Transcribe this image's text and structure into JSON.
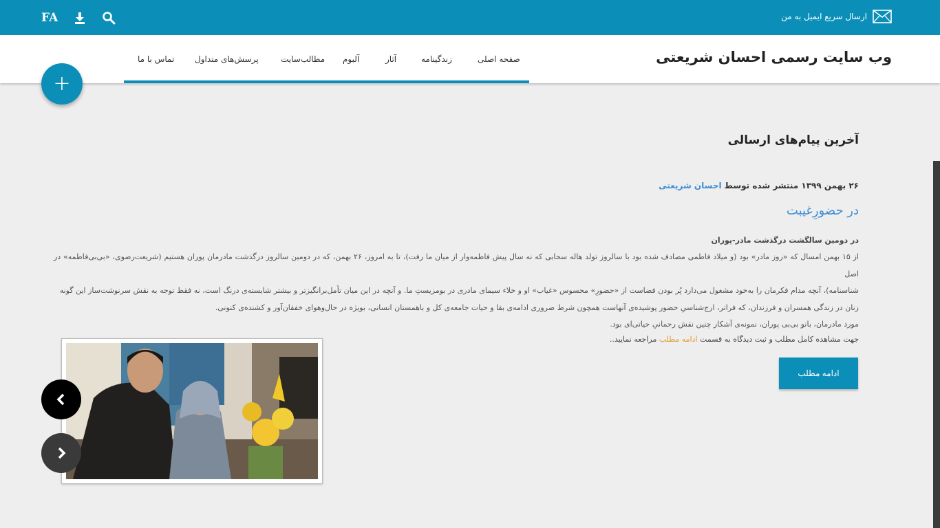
{
  "topbar": {
    "lang_label": "FA",
    "mail_label": "ارسال سریع ایمیل به من",
    "icons": [
      "search-icon",
      "download-icon",
      "mail-icon"
    ]
  },
  "header": {
    "site_title": "وب سایت رسمی احسان شریعتی",
    "nav": [
      {
        "label": "صفحه اصلی"
      },
      {
        "label": "زندگینامه"
      },
      {
        "label": "آثار"
      },
      {
        "label": "آلبوم"
      },
      {
        "label": "مطالب‌سایت"
      },
      {
        "label": "پرسش‌های متداول"
      },
      {
        "label": "تماس با ما"
      }
    ],
    "fab_label": "+"
  },
  "content": {
    "section_title": "آخرین پیام‌های ارسالی",
    "meta_prefix": "۲۶ بهمن ۱۳۹۹ منتشر شده توسط",
    "meta_author": "احسان شریعتی",
    "post_title": "در حضورِغیبت",
    "subtitle": "در دومین سالگشت درگذشت مادر-پوران",
    "body_lines": [
      "از ۱۵ بهمن امسال که «روز مادر» بود (و میلاد فاطمی مصادف شده بود با سالروز تولد هاله سحابی که نه سال پیش فاطمه‌وار از میان ما رفت)، تا به امروز، ۲۶ بهمن، که در دومین سالروز درگذشت مادرمان پوران هستیم (شریعت‌رضوی، «بی‌بی‌فاطمه» در اصل",
      "شناسنامه)، آنچه مدام فکرمان را به‌خود مشغول می‌دارد پُر بودن فضاست از «حضورِ» محسوس «غیاب» او و خلاء سیمای مادری در بومزیستِ ما. و آنچه در این میان تأمل‌برانگیزتر و بیشتر شایسته‌ی درنگ است، نه فقط توجه به نقش سرنوشت‌ساز این گونه",
      "زنان در زندگی همسران و فرزندان، که فراتر، ارج‌شناسیِ حضور پوشیده‌ی آنهاست همچون شرط ضروری ادامه‌ی بقا و حیات جامعه‌ی کل و باهمستان انسانی، بویژه در حال‌وهوای خفقان‌آور و کشنده‌ی کنونی.",
      "مورد مادرمان، بانو بی‌بی پوران، نمونه‌ی آشکار چنین نقش رحمانیِ حیاتی‌ای بود."
    ],
    "readmore_prefix": "جهت مشاهده کامل مطلب و ثبت دیدگاه به قسمت",
    "readmore_link": "ادامه مطلب",
    "readmore_suffix": "مراجعه نمایید..",
    "readmore_button": "ادامه مطلب"
  },
  "carousel": {
    "prev_icon": "chevron-left-icon",
    "next_icon": "chevron-right-icon"
  },
  "colors": {
    "primary": "#0b8fb9",
    "link": "#3d8ed6",
    "highlight": "#e09a2c",
    "background": "#eeeeee"
  }
}
